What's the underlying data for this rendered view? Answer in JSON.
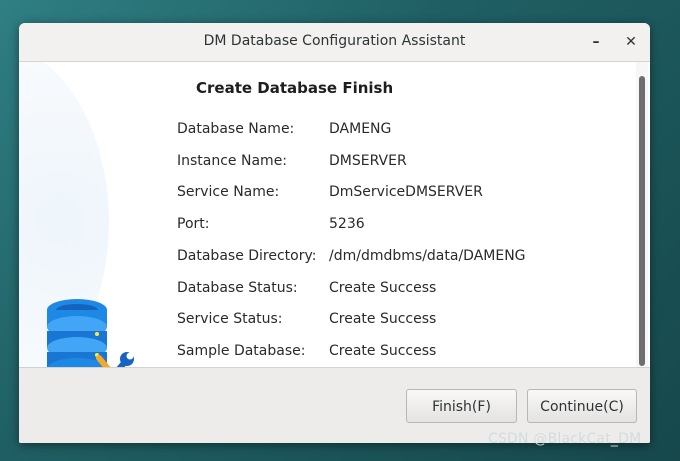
{
  "window": {
    "title": "DM Database Configuration Assistant",
    "minimize_glyph": "–",
    "close_glyph": "✕"
  },
  "content": {
    "heading": "Create Database Finish",
    "rows": [
      {
        "label": "Database Name:",
        "value": "DAMENG"
      },
      {
        "label": "Instance Name:",
        "value": "DMSERVER"
      },
      {
        "label": "Service Name:",
        "value": "DmServiceDMSERVER"
      },
      {
        "label": "Port:",
        "value": "5236"
      },
      {
        "label": "Database Directory:",
        "value": "/dm/dmdbms/data/DAMENG"
      },
      {
        "label": "Database Status:",
        "value": "Create Success"
      },
      {
        "label": "Service Status:",
        "value": "Create Success"
      },
      {
        "label": "Sample Database:",
        "value": "Create Success"
      }
    ],
    "icon": "database-tools-icon"
  },
  "footer": {
    "finish_label": "Finish(F)",
    "continue_label": "Continue(C)"
  },
  "watermark": "CSDN @BlackCat_DM",
  "colors": {
    "desktop": "#1f5f63",
    "db_blue": "#1e88e5",
    "db_light": "#64b5f6",
    "wrench": "#1565c0",
    "screwdriver": "#f9a825"
  }
}
